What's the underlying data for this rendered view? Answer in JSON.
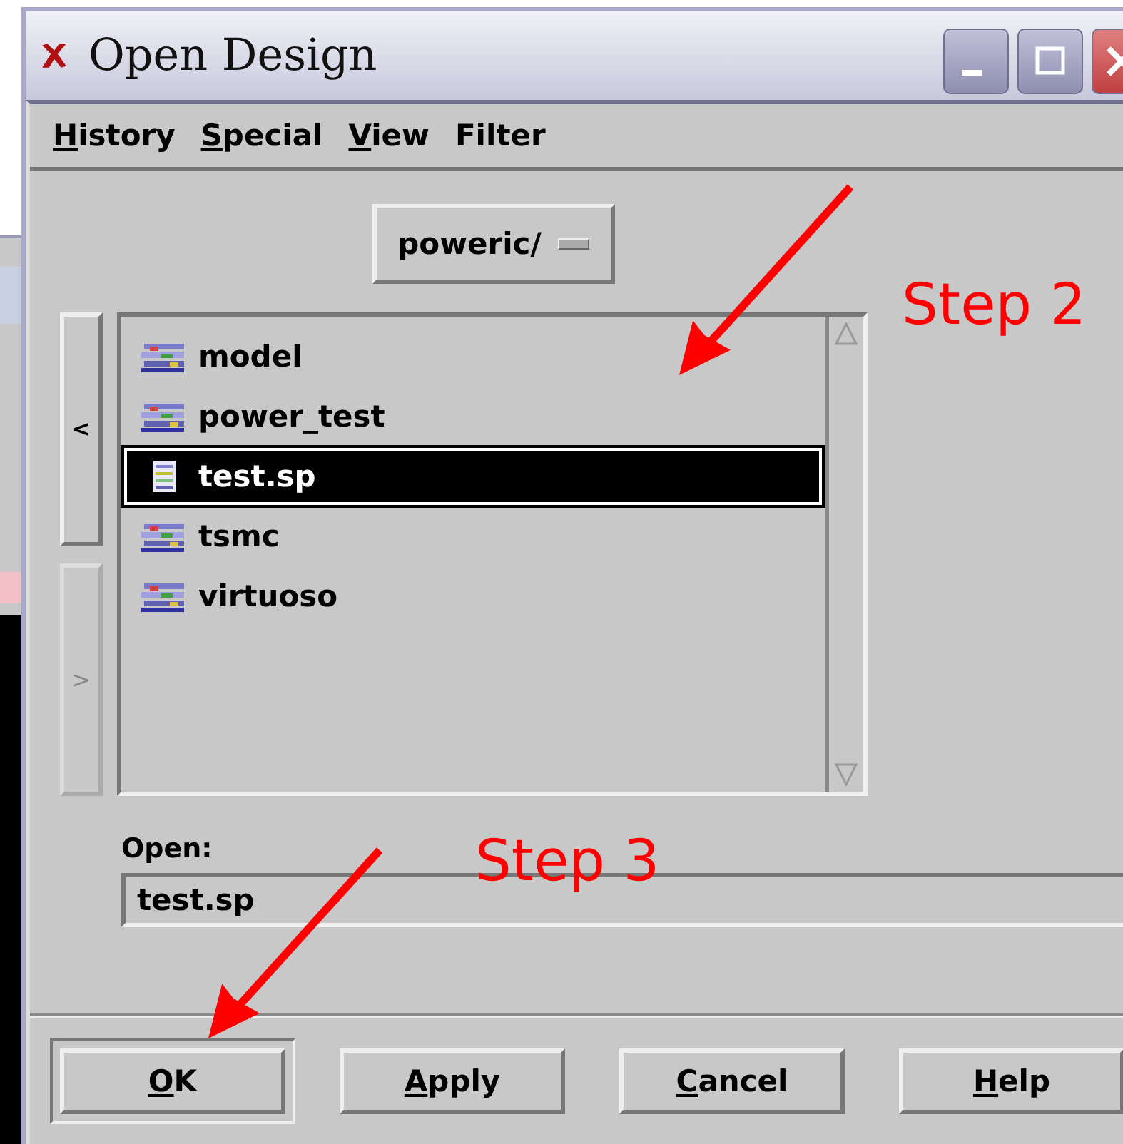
{
  "window": {
    "title": "Open Design"
  },
  "menu": [
    {
      "label": "History",
      "underline_first": true
    },
    {
      "label": "Special",
      "underline_first": true
    },
    {
      "label": "View",
      "underline_first": true
    },
    {
      "label": "Filter",
      "underline_first": false
    }
  ],
  "directory": {
    "value": "poweric/"
  },
  "nav": [
    {
      "label": "<",
      "disabled": false
    },
    {
      "label": ">",
      "disabled": true
    }
  ],
  "files": [
    {
      "name": "model",
      "kind": "library",
      "selected": false
    },
    {
      "name": "power_test",
      "kind": "library",
      "selected": false
    },
    {
      "name": "test.sp",
      "kind": "file",
      "selected": true
    },
    {
      "name": "tsmc",
      "kind": "library",
      "selected": false
    },
    {
      "name": "virtuoso",
      "kind": "library",
      "selected": false
    }
  ],
  "open_field": {
    "label": "Open:",
    "value": "test.sp"
  },
  "buttons": [
    {
      "label": "OK",
      "default": true
    },
    {
      "label": "Apply",
      "default": false
    },
    {
      "label": "Cancel",
      "default": false
    },
    {
      "label": "Help",
      "default": false
    }
  ],
  "annotations": [
    {
      "text": "Step 2"
    },
    {
      "text": "Step 3"
    }
  ]
}
